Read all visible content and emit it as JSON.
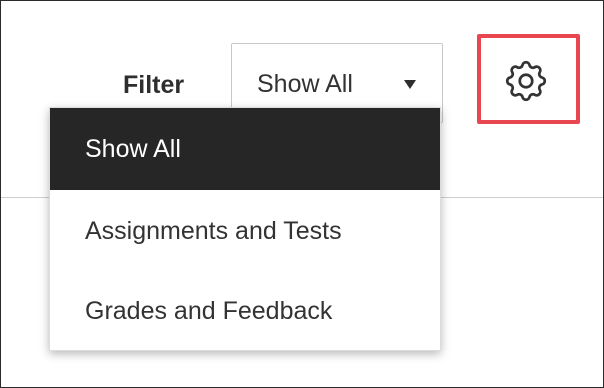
{
  "filter": {
    "label": "Filter",
    "selected_value": "Show All",
    "options": [
      {
        "label": "Show All",
        "selected": true
      },
      {
        "label": "Assignments and Tests",
        "selected": false
      },
      {
        "label": "Grades and Feedback",
        "selected": false
      }
    ]
  },
  "settings": {
    "icon": "gear-icon",
    "highlight_color": "#e8474f"
  },
  "colors": {
    "selected_item_bg": "#262626",
    "text": "#333333"
  }
}
